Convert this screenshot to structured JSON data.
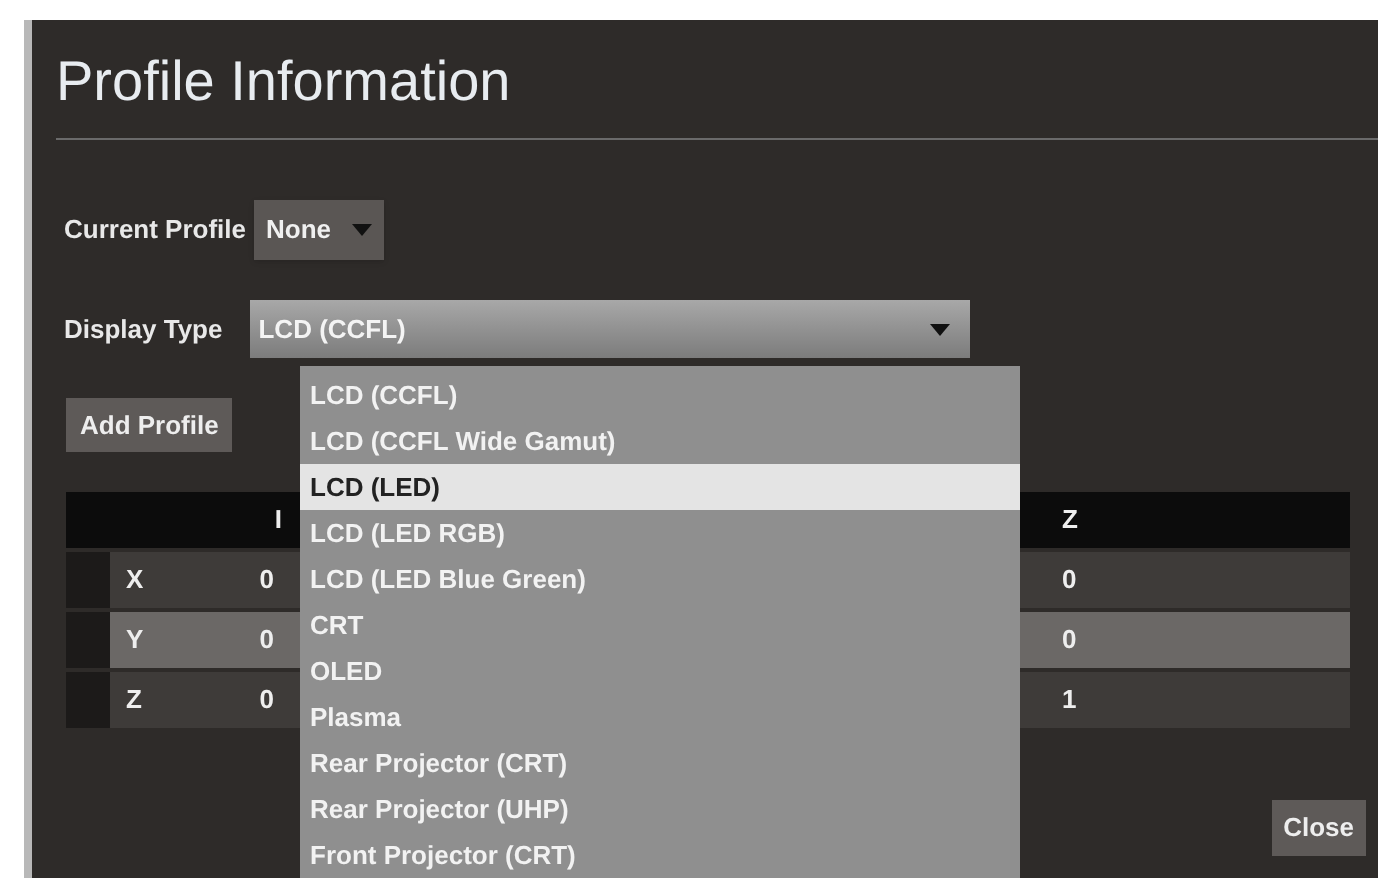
{
  "title": "Profile Information",
  "current_profile": {
    "label": "Current Profile",
    "value": "None"
  },
  "display_type": {
    "label": "Display Type",
    "value": "LCD (CCFL)",
    "expanded": true,
    "options": [
      {
        "label": "LCD (CCFL)",
        "highlighted": false
      },
      {
        "label": "LCD (CCFL Wide Gamut)",
        "highlighted": false
      },
      {
        "label": "LCD (LED)",
        "highlighted": true
      },
      {
        "label": "LCD (LED RGB)",
        "highlighted": false
      },
      {
        "label": "LCD (LED Blue Green)",
        "highlighted": false
      },
      {
        "label": "CRT",
        "highlighted": false
      },
      {
        "label": "OLED",
        "highlighted": false
      },
      {
        "label": "Plasma",
        "highlighted": false
      },
      {
        "label": "Rear Projector (CRT)",
        "highlighted": false
      },
      {
        "label": "Rear Projector (UHP)",
        "highlighted": false
      },
      {
        "label": "Front Projector (CRT)",
        "highlighted": false
      }
    ]
  },
  "add_profile_button": "Add Profile",
  "table": {
    "columns": [
      "I",
      "Z"
    ],
    "rows": [
      {
        "label": "X",
        "values": [
          "0",
          "0"
        ],
        "selected": false
      },
      {
        "label": "Y",
        "values": [
          "0",
          "0"
        ],
        "selected": true
      },
      {
        "label": "Z",
        "values": [
          "0",
          "1"
        ],
        "selected": false
      }
    ]
  },
  "close_button": "Close"
}
